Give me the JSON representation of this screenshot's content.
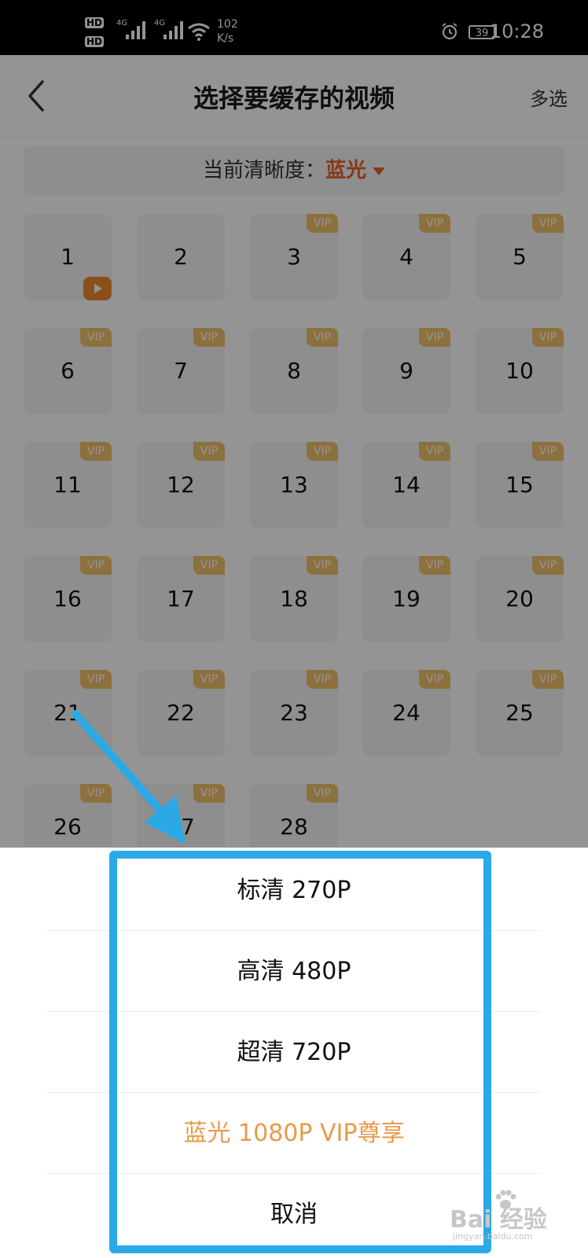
{
  "status_bar": {
    "hd1": "HD",
    "hd2": "HD",
    "sig1": "4G",
    "sig2": "4G",
    "speed_value": "102",
    "speed_unit": "K/s",
    "battery": "39",
    "time": "10:28"
  },
  "header": {
    "title": "选择要缓存的视频",
    "multi_select": "多选"
  },
  "quality": {
    "label": "当前清晰度：",
    "value": "蓝光"
  },
  "episodes": [
    {
      "num": "1",
      "vip": false,
      "playing": true
    },
    {
      "num": "2",
      "vip": false,
      "playing": false
    },
    {
      "num": "3",
      "vip": true,
      "playing": false
    },
    {
      "num": "4",
      "vip": true,
      "playing": false
    },
    {
      "num": "5",
      "vip": true,
      "playing": false
    },
    {
      "num": "6",
      "vip": true,
      "playing": false
    },
    {
      "num": "7",
      "vip": true,
      "playing": false
    },
    {
      "num": "8",
      "vip": true,
      "playing": false
    },
    {
      "num": "9",
      "vip": true,
      "playing": false
    },
    {
      "num": "10",
      "vip": true,
      "playing": false
    },
    {
      "num": "11",
      "vip": true,
      "playing": false
    },
    {
      "num": "12",
      "vip": true,
      "playing": false
    },
    {
      "num": "13",
      "vip": true,
      "playing": false
    },
    {
      "num": "14",
      "vip": true,
      "playing": false
    },
    {
      "num": "15",
      "vip": true,
      "playing": false
    },
    {
      "num": "16",
      "vip": true,
      "playing": false
    },
    {
      "num": "17",
      "vip": true,
      "playing": false
    },
    {
      "num": "18",
      "vip": true,
      "playing": false
    },
    {
      "num": "19",
      "vip": true,
      "playing": false
    },
    {
      "num": "20",
      "vip": true,
      "playing": false
    },
    {
      "num": "21",
      "vip": true,
      "playing": false
    },
    {
      "num": "22",
      "vip": true,
      "playing": false
    },
    {
      "num": "23",
      "vip": true,
      "playing": false
    },
    {
      "num": "24",
      "vip": true,
      "playing": false
    },
    {
      "num": "25",
      "vip": true,
      "playing": false
    },
    {
      "num": "26",
      "vip": true,
      "playing": false
    },
    {
      "num": "27",
      "vip": true,
      "playing": false
    },
    {
      "num": "28",
      "vip": true,
      "playing": false
    }
  ],
  "vip_badge": "VIP",
  "sheet": {
    "options": [
      {
        "label": "标清 270P",
        "style": "normal"
      },
      {
        "label": "高清 480P",
        "style": "normal"
      },
      {
        "label": "超清 720P",
        "style": "normal"
      },
      {
        "label": "蓝光 1080P  VIP尊享",
        "style": "vip"
      },
      {
        "label": "取消",
        "style": "cancel"
      }
    ]
  },
  "watermark": {
    "brand": "Bai 经验",
    "url": "jingyan.baidu.com"
  },
  "colors": {
    "accent": "#e8612c",
    "vip_badge": "#f1c36b",
    "highlight_frame": "#2aa9e6",
    "vip_option": "#e89a4a"
  }
}
